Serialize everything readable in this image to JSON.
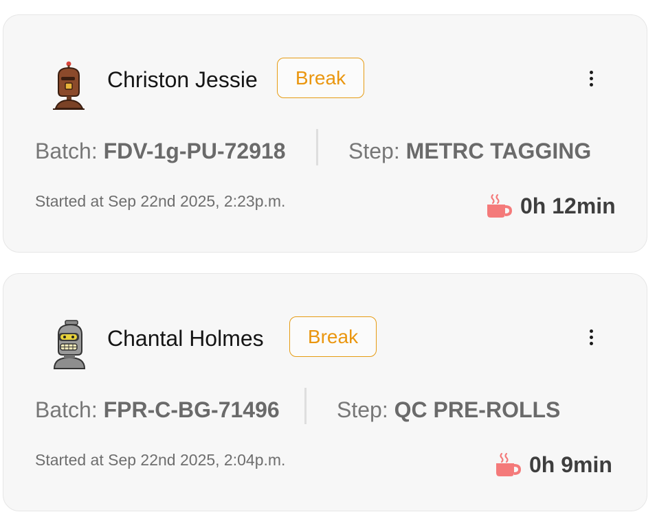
{
  "cards": [
    {
      "name": "Christon Jessie",
      "status": "Break",
      "batch_label": "Batch:",
      "batch_value": "FDV-1g-PU-72918",
      "step_label": "Step:",
      "step_value": "METRC TAGGING",
      "started": "Started at Sep 22nd 2025, 2:23p.m.",
      "duration": "0h 12min",
      "avatar_icon": "brown-robot-avatar",
      "status_color": "#ea960f",
      "cup_color": "#f47a7a"
    },
    {
      "name": "Chantal Holmes",
      "status": "Break",
      "batch_label": "Batch:",
      "batch_value": "FPR-C-BG-71496",
      "step_label": "Step:",
      "step_value": "QC PRE-ROLLS",
      "started": "Started at Sep 22nd 2025, 2:04p.m.",
      "duration": "0h 9min",
      "avatar_icon": "grey-robot-avatar",
      "status_color": "#ea960f",
      "cup_color": "#f47a7a"
    }
  ]
}
